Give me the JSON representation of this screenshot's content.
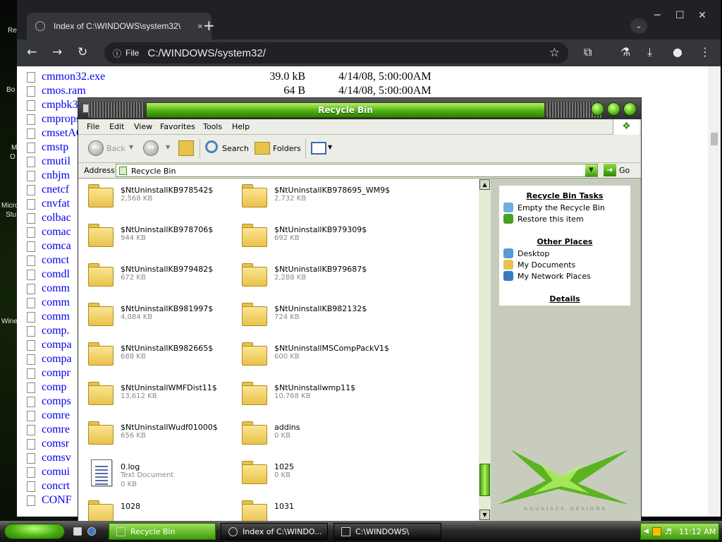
{
  "desktop": {
    "labels": [
      "Re",
      "Bo",
      "M",
      "O",
      "Micro",
      "Stu",
      "Wine"
    ]
  },
  "browser": {
    "tab_title": "Index of C:\\WINDOWS\\system32\\",
    "new_tab": "+",
    "tab_dropdown": "⌄",
    "window_controls": {
      "minimize": "─",
      "maximize": "☐",
      "close": "✕"
    },
    "nav": {
      "back": "←",
      "forward": "→",
      "reload": "↻"
    },
    "omnibox": {
      "info_icon": "ⓘ",
      "scheme": "File",
      "url": "C:/WINDOWS/system32/",
      "star": "☆"
    },
    "toolbar_icons": {
      "extensions": "⧉",
      "labs": "⚗",
      "download": "⤓",
      "profile": "●",
      "menu": "⋮"
    },
    "files": [
      {
        "name": "cmmon32.exe",
        "size": "39.0 kB",
        "date": "4/14/08, 5:00:00AM"
      },
      {
        "name": "cmos.ram",
        "size": "64 B",
        "date": "4/14/08, 5:00:00AM"
      },
      {
        "name": "cmpbk3"
      },
      {
        "name": "cmprops"
      },
      {
        "name": "cmsetAC"
      },
      {
        "name": "cmstp"
      },
      {
        "name": "cmutil"
      },
      {
        "name": "cnbjm"
      },
      {
        "name": "cnetcf"
      },
      {
        "name": "cnvfat"
      },
      {
        "name": "colbac"
      },
      {
        "name": "comac"
      },
      {
        "name": "comca"
      },
      {
        "name": "comct"
      },
      {
        "name": "comdl"
      },
      {
        "name": "comm"
      },
      {
        "name": "comm"
      },
      {
        "name": "comm"
      },
      {
        "name": "comp."
      },
      {
        "name": "compa"
      },
      {
        "name": "compa"
      },
      {
        "name": "compr"
      },
      {
        "name": "comp"
      },
      {
        "name": "comps"
      },
      {
        "name": "comre"
      },
      {
        "name": "comre"
      },
      {
        "name": "comsr"
      },
      {
        "name": "comsv"
      },
      {
        "name": "comui"
      },
      {
        "name": "concrt"
      },
      {
        "name": "CONF"
      }
    ]
  },
  "explorer": {
    "title": "Recycle Bin",
    "menu": [
      "File",
      "Edit",
      "View",
      "Favorites",
      "Tools",
      "Help"
    ],
    "toolbar": {
      "back": "Back",
      "search": "Search",
      "folders": "Folders"
    },
    "address_label": "Address",
    "address_value": "Recycle Bin",
    "go_label": "Go",
    "items": [
      {
        "name": "$NtUninstallKB978542$",
        "size": "2,568 KB",
        "kind": "folder"
      },
      {
        "name": "$NtUninstallKB978695_WM9$",
        "size": "2,732 KB",
        "kind": "folder"
      },
      {
        "name": "$NtUninstallKB978706$",
        "size": "944 KB",
        "kind": "folder"
      },
      {
        "name": "$NtUninstallKB979309$",
        "size": "692 KB",
        "kind": "folder"
      },
      {
        "name": "$NtUninstallKB979482$",
        "size": "672 KB",
        "kind": "folder"
      },
      {
        "name": "$NtUninstallKB979687$",
        "size": "2,288 KB",
        "kind": "folder"
      },
      {
        "name": "$NtUninstallKB981997$",
        "size": "4,084 KB",
        "kind": "folder"
      },
      {
        "name": "$NtUninstallKB982132$",
        "size": "724 KB",
        "kind": "folder"
      },
      {
        "name": "$NtUninstallKB982665$",
        "size": "688 KB",
        "kind": "folder"
      },
      {
        "name": "$NtUninstallMSCompPackV1$",
        "size": "600 KB",
        "kind": "folder"
      },
      {
        "name": "$NtUninstallWMFDist11$",
        "size": "13,612 KB",
        "kind": "folder"
      },
      {
        "name": "$NtUninstallwmp11$",
        "size": "10,768 KB",
        "kind": "folder"
      },
      {
        "name": "$NtUninstallWudf01000$",
        "size": "656 KB",
        "kind": "folder"
      },
      {
        "name": "addins",
        "size": "0 KB",
        "kind": "folder"
      },
      {
        "name": "0.log",
        "type": "Text Document",
        "size": "0 KB",
        "kind": "text"
      },
      {
        "name": "1025",
        "size": "0 KB",
        "kind": "folder"
      },
      {
        "name": "1028",
        "kind": "folder"
      },
      {
        "name": "1031",
        "kind": "folder"
      }
    ],
    "tasks": {
      "heading": "Recycle Bin Tasks",
      "items": [
        "Empty the Recycle Bin",
        "Restore this item"
      ],
      "other_heading": "Other Places",
      "other_items": [
        "Desktop",
        "My Documents",
        "My Network Places"
      ],
      "details_heading": "Details"
    },
    "logo_text": "AQUAJACK DESIGNS"
  },
  "taskbar": {
    "tasks": [
      "Recycle Bin",
      "Index of C:\\WINDO...",
      "C:\\WINDOWS\\"
    ],
    "clock": "11:12 AM"
  },
  "colors": {
    "accent_green": "#4fb010",
    "link_blue": "#0000ee",
    "chrome_dark": "#202124"
  }
}
